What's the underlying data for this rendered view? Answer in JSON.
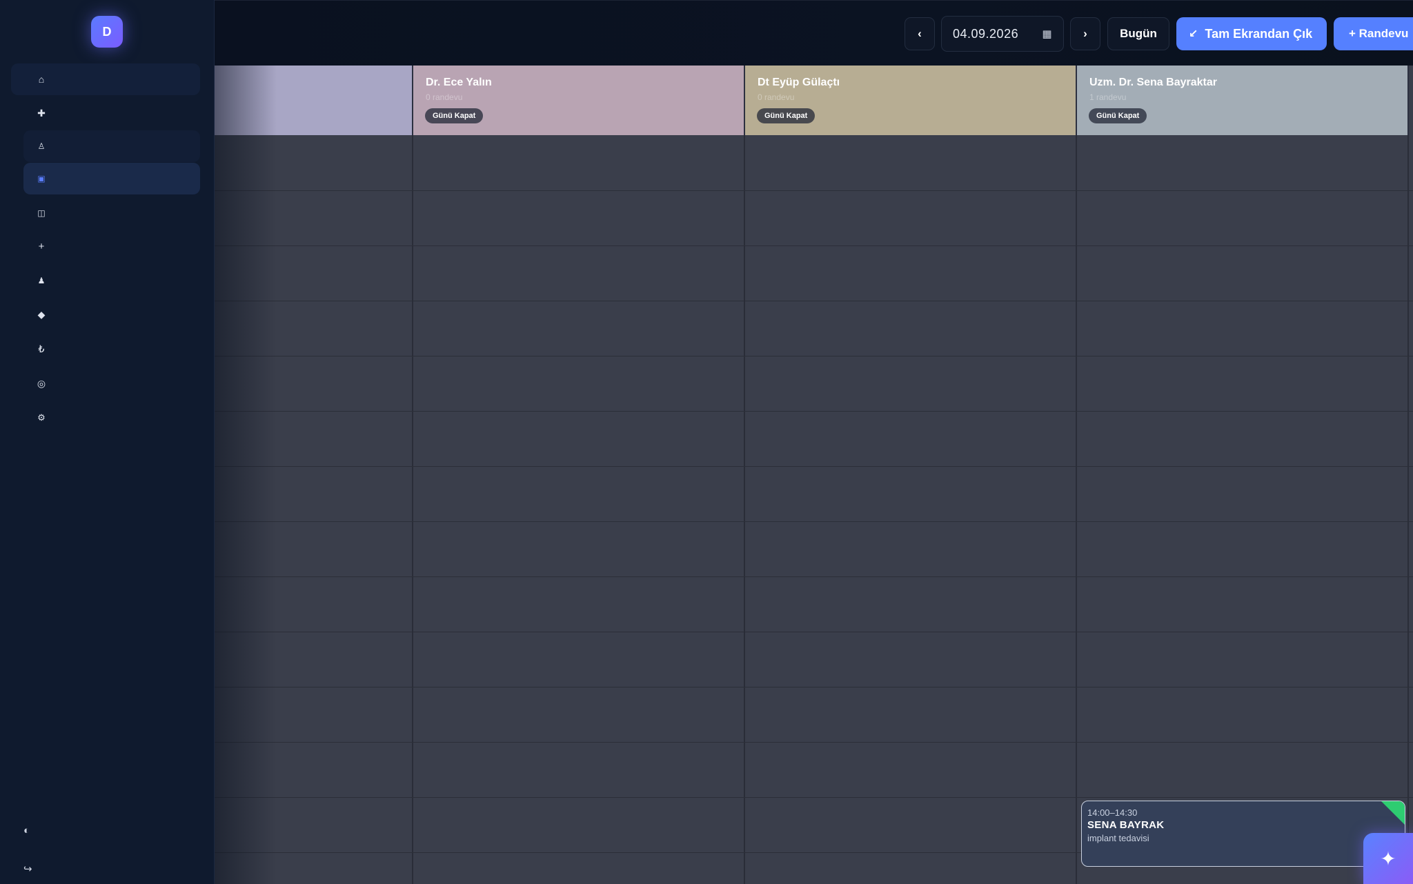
{
  "sidebar": {
    "logo_letter": "D",
    "items": [
      {
        "icon": "home-icon",
        "glyph": "⌂"
      },
      {
        "icon": "plus-cross-icon",
        "glyph": "✚"
      },
      {
        "icon": "user-outline-icon",
        "glyph": "♙"
      },
      {
        "icon": "calendar-square-icon",
        "glyph": "▣"
      },
      {
        "icon": "columns-icon",
        "glyph": "◫"
      },
      {
        "icon": "plus-icon",
        "glyph": "+"
      },
      {
        "icon": "user-filled-icon",
        "glyph": "♟"
      },
      {
        "icon": "diamond-icon",
        "glyph": "◆"
      },
      {
        "icon": "lira-icon",
        "glyph": "₺"
      },
      {
        "icon": "target-icon",
        "glyph": "◎"
      },
      {
        "icon": "gear-icon",
        "glyph": "⚙"
      }
    ],
    "bottom": [
      {
        "icon": "theme-toggle-icon",
        "glyph": "◐"
      },
      {
        "icon": "logout-icon",
        "glyph": "↪"
      }
    ]
  },
  "toolbar": {
    "prev": "‹",
    "date_value": "04.09.2026",
    "calendar_glyph": "▦",
    "next": "›",
    "today_label": "Bugün",
    "exit_fullscreen_icon": "↙",
    "exit_fullscreen_label": "Tam Ekrandan Çık",
    "new_appointment_label": "+ Randevu"
  },
  "calendar": {
    "columns": [
      {
        "name": "",
        "count": "",
        "close_label": "",
        "color": "#a8a6c5"
      },
      {
        "name": "Dr. Ece Yalın",
        "count": "0 randevu",
        "close_label": "Günü Kapat",
        "color": "#b9a4b3"
      },
      {
        "name": "Dt Eyüp Gülaçtı",
        "count": "0 randevu",
        "close_label": "Günü Kapat",
        "color": "#b7ad93"
      },
      {
        "name": "Uzm. Dr. Sena Bayraktar",
        "count": "1 randevu",
        "close_label": "Günü Kapat",
        "color": "#a3adb6"
      }
    ],
    "appointment": {
      "time": "14:00–14:30",
      "patient": "SENA BAYRAK",
      "treatment": "implant tedavisi",
      "status_color": "#2ecc71"
    }
  },
  "fab": {
    "glyph": "✦"
  }
}
